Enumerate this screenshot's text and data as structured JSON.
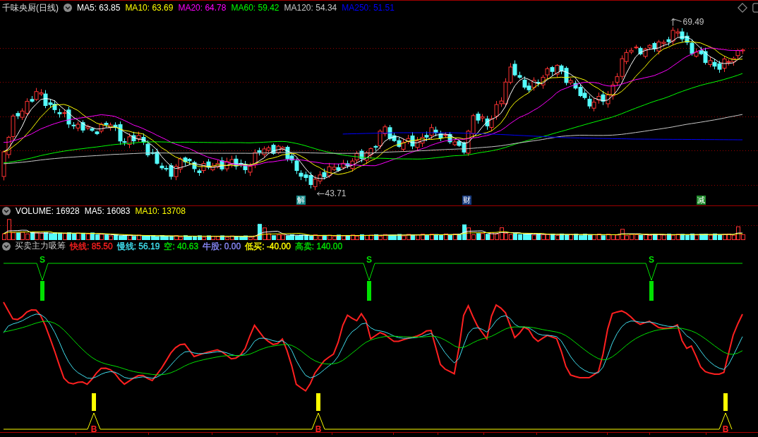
{
  "price_panel": {
    "title": "千味央厨(日线)",
    "indicators": [
      {
        "label": "MA5: 63.85",
        "color": "#ffffff"
      },
      {
        "label": "MA10: 63.69",
        "color": "#ffff00"
      },
      {
        "label": "MA20: 64.78",
        "color": "#ff00ff"
      },
      {
        "label": "MA60: 59.42",
        "color": "#00ff00"
      },
      {
        "label": "MA120: 54.34",
        "color": "#c8c8c8"
      },
      {
        "label": "MA250: 51.51",
        "color": "#0000ff"
      }
    ],
    "high_label": "69.49",
    "low_label": "43.71",
    "event_tags": [
      {
        "text": "解",
        "color": "#168a8a"
      },
      {
        "text": "财",
        "color": "#1a3c80"
      },
      {
        "text": "减",
        "color": "#1e8a2a"
      }
    ]
  },
  "volume_panel": {
    "indicators": [
      {
        "label": "VOLUME: 16928",
        "color": "#ffffff"
      },
      {
        "label": "MA5: 16083",
        "color": "#ffffff"
      },
      {
        "label": "MA10: 13708",
        "color": "#ffff00"
      }
    ]
  },
  "indicator_panel": {
    "title": "买卖主力吸筹",
    "indicators": [
      {
        "label": "快线: 85.50",
        "color": "#ff2020"
      },
      {
        "label": "慢线: 56.19",
        "color": "#40e0f0"
      },
      {
        "label": "空: 40.63",
        "color": "#00e000"
      },
      {
        "label": "牛股: 0.00",
        "color": "#8c8cff"
      },
      {
        "label": "低买: -40.00",
        "color": "#ffff00"
      },
      {
        "label": "高卖: 140.00",
        "color": "#00e000"
      }
    ],
    "sell_signals": [
      {
        "label": "S"
      },
      {
        "label": "S"
      },
      {
        "label": "S"
      }
    ],
    "buy_signals": [
      {
        "label": "B"
      },
      {
        "label": "B"
      },
      {
        "label": "B"
      }
    ]
  }
}
